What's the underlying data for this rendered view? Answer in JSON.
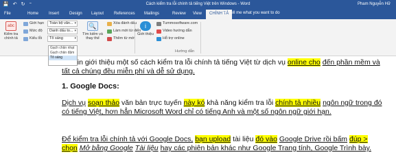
{
  "titlebar": {
    "icons": [
      "💾",
      "↶",
      "↻",
      "⁼"
    ],
    "title": "Cách kiểm tra lỗi chính tả tiếng Việt trên Windows - Word",
    "user": "Pham Nguyễn Hữ"
  },
  "tabs": [
    "File",
    "Home",
    "Insert",
    "Design",
    "Layout",
    "References",
    "Mailings",
    "Review",
    "View",
    "CHÍNH TẢ"
  ],
  "tell_me": "Tell me what you want to do",
  "ribbon": {
    "check": "Kiểm tra chính tả",
    "gioi_han": "Giới hạn",
    "muc_do": "Mức độ",
    "kieu_loi": "Kiểu lỗi",
    "combo1": "Toàn bộ văn...",
    "combo2": "Danh dấu to...",
    "combo3": "Tô sáng",
    "find_replace": "Tìm kiếm và thay thế",
    "delete_marks": "Xóa đánh dấu",
    "more_words": "Làm mới từ điển",
    "add_word": "Thêm từ mới",
    "intro": "Giới thiệu",
    "site": "Tummosoftware.com",
    "video": "Video hướng dẫn",
    "online": "Hỗ trợ online",
    "group_label": "Hướng dẫn"
  },
  "dropdown_items": [
    "Gạch chân nhạt",
    "Gạch chân đậm",
    "Tô sáng"
  ],
  "document": {
    "p1_a": "NS xin giới thiệu một số cách kiểm tra lỗi chính tả tiếng Việt từ dịch vụ",
    "p1_hl": "online cho",
    "p1_b": "đến phần mềm và tất cả chúng đều miễn phí và dễ sử dụng.",
    "heading": "1. Google Docs:",
    "p2_a": "Dịch vụ",
    "p2_hl1": "soạn thảo",
    "p2_b": "văn bản trực tuyến",
    "p2_hl2": "này kó",
    "p2_c": "khả năng kiểm tra lỗi",
    "p2_hl3": "chính tả nhiều",
    "p2_d": "ngôn ngữ trong đó có tiếng Việt, hơn hẳn Microsoft Word chỉ có tiếng Anh và một số ngôn ngữ giới hạn.",
    "p3_a": "Để kiểm tra lỗi chính tả với Google Docs,",
    "p3_hl1": "bạn upload",
    "p3_b": "tài liệu",
    "p3_hl2": "đó vào",
    "p3_c": "Google Drive rồi bấm",
    "p3_hl3": "đúp > chọn",
    "p3_d": "Mở bằng Google",
    "p3_e": "Tài liệu",
    "p3_f": "hay các phiên bản khác như Google Trang tính, Google Trình bày."
  }
}
